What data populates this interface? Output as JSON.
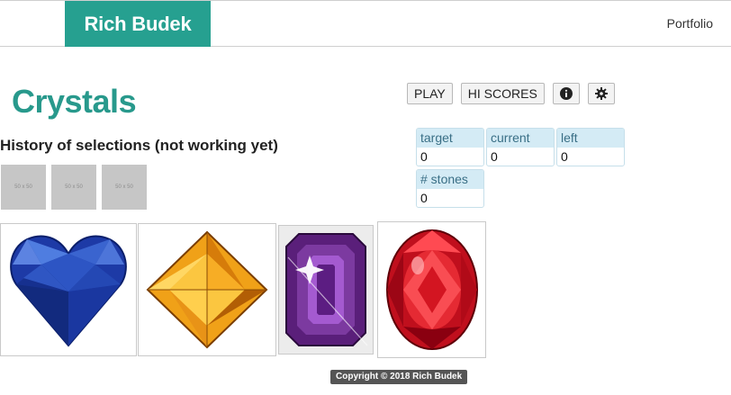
{
  "navbar": {
    "brand": "Rich Budek",
    "portfolio_link": "Portfolio"
  },
  "page": {
    "title": "Crystals",
    "history_heading": "History of selections (not working yet)",
    "history_placeholders": [
      "50 x 50",
      "50 x 50",
      "50 x 50"
    ]
  },
  "controls": {
    "play_label": "PLAY",
    "hiscores_label": "HI SCORES",
    "info_icon": "info-icon",
    "settings_icon": "gear-icon"
  },
  "stats": {
    "target": {
      "label": "target",
      "value": "0"
    },
    "current": {
      "label": "current",
      "value": "0"
    },
    "left": {
      "label": "left",
      "value": "0"
    },
    "stones": {
      "label": "# stones",
      "value": "0"
    }
  },
  "crystals": [
    {
      "name": "blue heart sapphire",
      "color": "#1f3fa8"
    },
    {
      "name": "orange square topaz",
      "color": "#f2a21a"
    },
    {
      "name": "purple emerald-cut amethyst",
      "color": "#6a2a86"
    },
    {
      "name": "red oval ruby",
      "color": "#c8101e"
    }
  ],
  "footer": {
    "copyright": "Copyright © 2018 Rich Budek"
  },
  "colors": {
    "brand": "#26a090",
    "title": "#28998c",
    "stat_header": "#d4ebf5"
  }
}
